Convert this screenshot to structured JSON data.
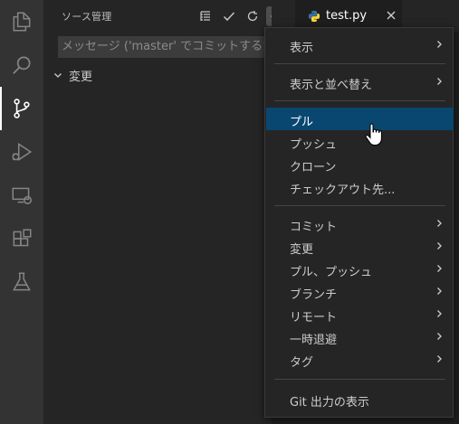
{
  "activity_bar": {
    "items": [
      {
        "icon": "explorer-icon"
      },
      {
        "icon": "search-icon"
      },
      {
        "icon": "source-control-icon",
        "active": true
      },
      {
        "icon": "run-debug-icon"
      },
      {
        "icon": "remote-explorer-icon"
      },
      {
        "icon": "extensions-icon"
      },
      {
        "icon": "testing-icon"
      }
    ]
  },
  "sidebar": {
    "title": "ソース管理",
    "actions": [
      "view-as-tree-icon",
      "commit-check-icon",
      "refresh-icon",
      "more-actions-icon"
    ],
    "commit_placeholder": "メッセージ ('master' でコミットするた",
    "changes_label": "変更"
  },
  "editor": {
    "tab_label": "test.py",
    "tab_icon": "python-icon"
  },
  "menu": {
    "items": [
      {
        "label": "表示",
        "submenu": true
      },
      {
        "label": "表示と並べ替え",
        "submenu": true
      },
      {
        "label": "プル",
        "submenu": false,
        "selected": true
      },
      {
        "label": "プッシュ",
        "submenu": false
      },
      {
        "label": "クローン",
        "submenu": false
      },
      {
        "label": "チェックアウト先...",
        "submenu": false
      },
      {
        "label": "コミット",
        "submenu": true
      },
      {
        "label": "変更",
        "submenu": true
      },
      {
        "label": "プル、プッシュ",
        "submenu": true
      },
      {
        "label": "ブランチ",
        "submenu": true
      },
      {
        "label": "リモート",
        "submenu": true
      },
      {
        "label": "一時退避",
        "submenu": true
      },
      {
        "label": "タグ",
        "submenu": true
      },
      {
        "label": "Git 出力の表示",
        "submenu": false
      }
    ]
  },
  "colors": {
    "activity_bar_bg": "#333333",
    "sidebar_bg": "#252526",
    "editor_bg": "#1e1e1e",
    "menu_selected_bg": "#094771",
    "python_blue": "#3572A5",
    "python_yellow": "#ffd43b"
  }
}
